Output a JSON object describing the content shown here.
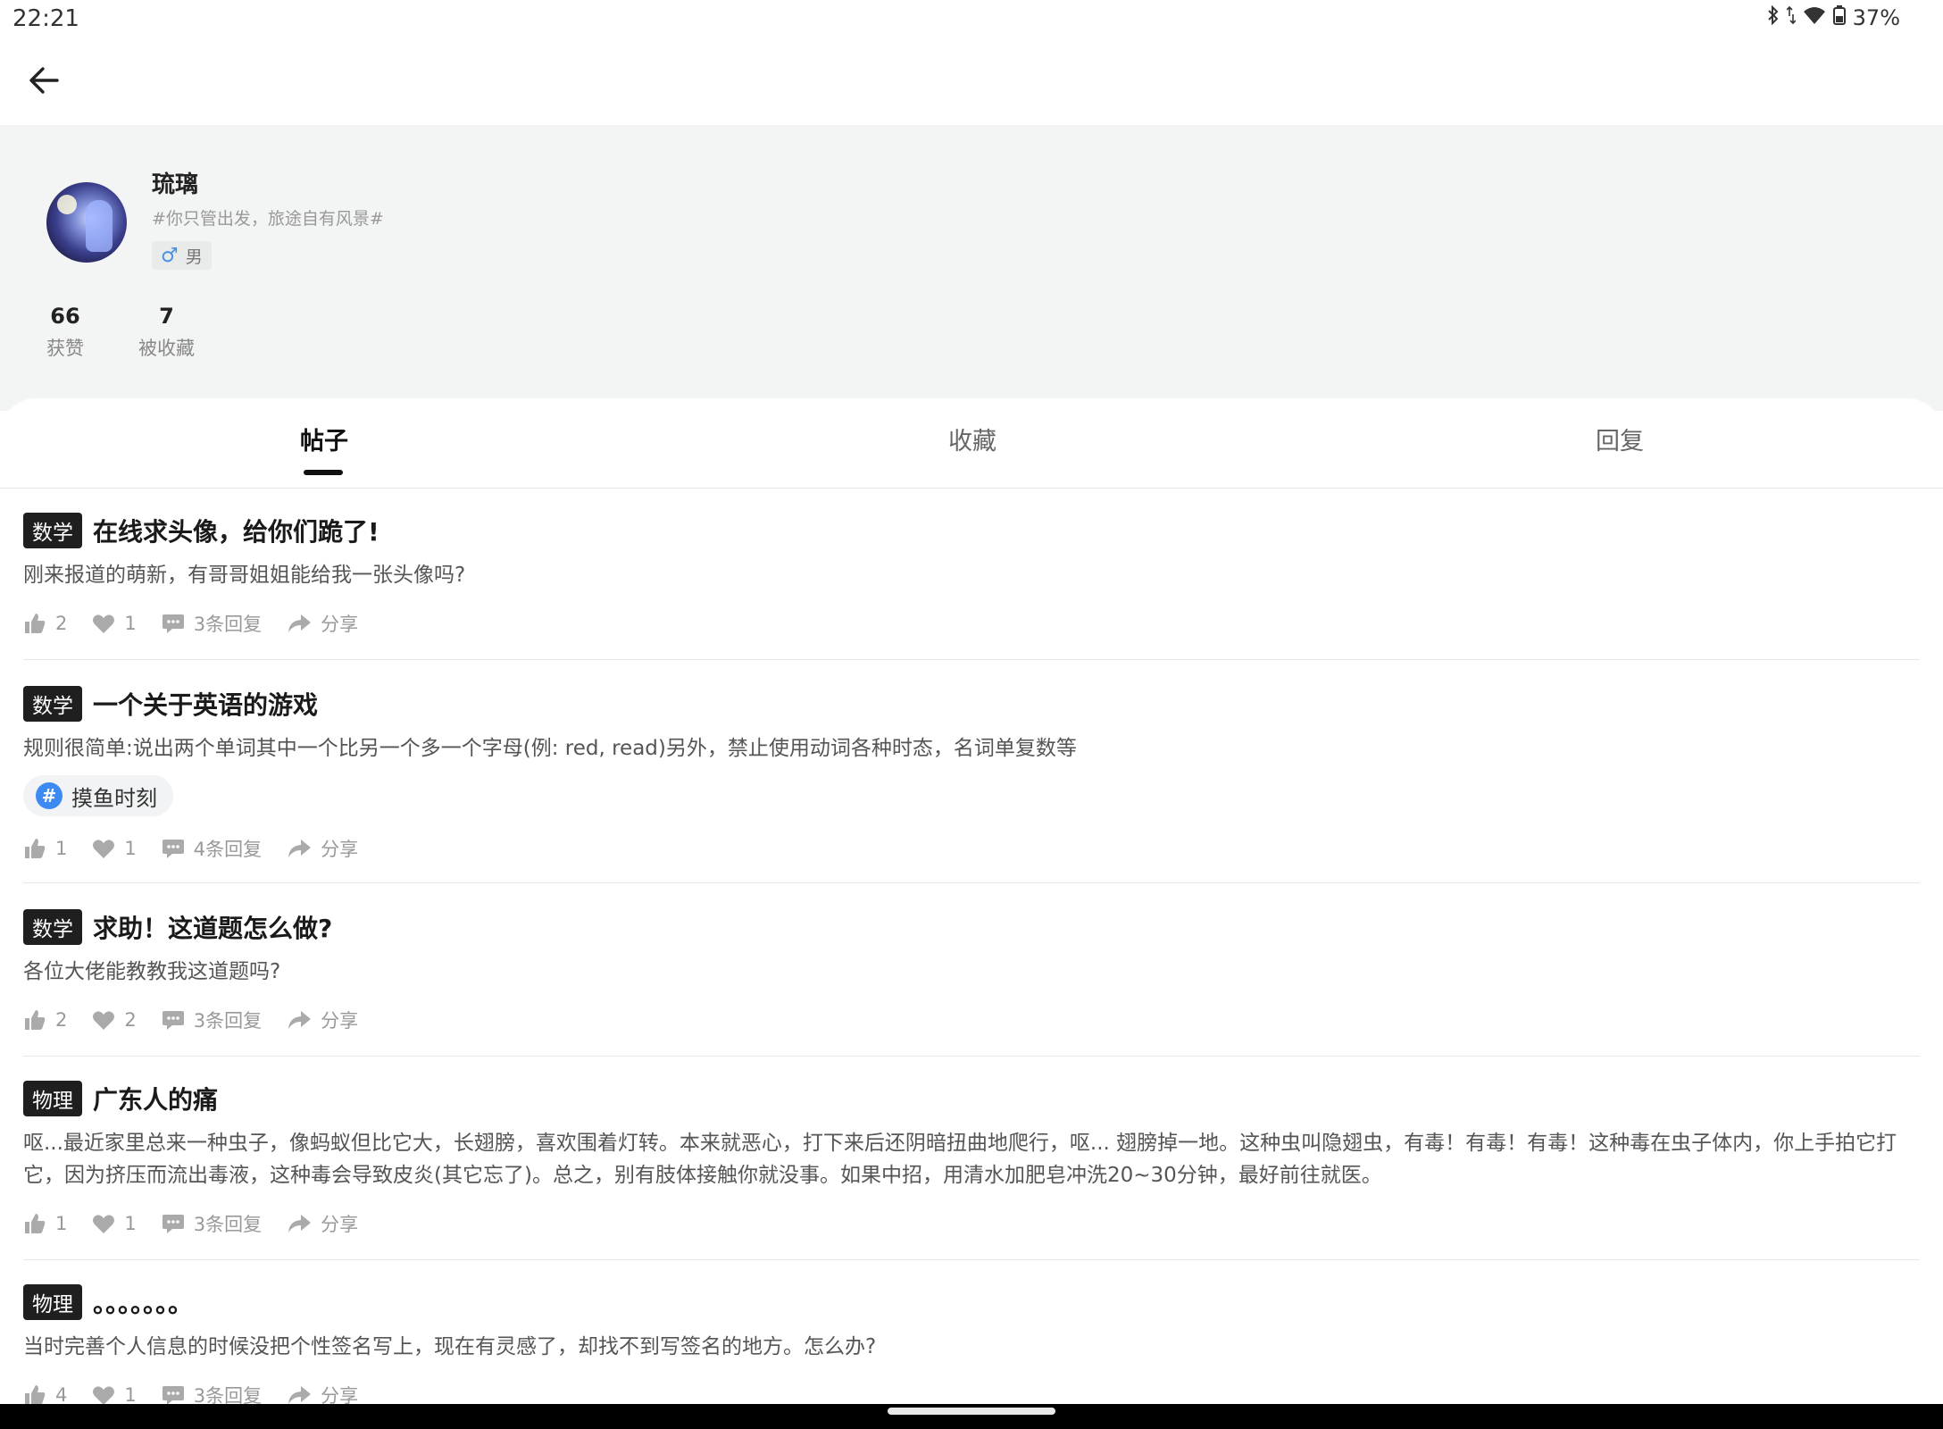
{
  "status": {
    "time": "22:21",
    "battery": "37%"
  },
  "profile": {
    "name": "琉璃",
    "signature": "#你只管出发，旅途自有风景#",
    "gender": "男",
    "stats": [
      {
        "num": "66",
        "label": "获赞"
      },
      {
        "num": "7",
        "label": "被收藏"
      }
    ]
  },
  "tabs": [
    "帖子",
    "收藏",
    "回复"
  ],
  "active_tab": "帖子",
  "posts": [
    {
      "tag": "数学",
      "title": "在线求头像，给你们跪了!",
      "body": "刚来报道的萌新，有哥哥姐姐能给我一张头像吗?",
      "likes": "2",
      "favs": "1",
      "replies": "3条回复",
      "share": "分享"
    },
    {
      "tag": "数学",
      "title": "一个关于英语的游戏",
      "body": "规则很简单:说出两个单词其中一个比另一个多一个字母(例: red, read)另外，禁止使用动词各种时态，名词单复数等",
      "topic": "摸鱼时刻",
      "likes": "1",
      "favs": "1",
      "replies": "4条回复",
      "share": "分享"
    },
    {
      "tag": "数学",
      "title": "求助！这道题怎么做?",
      "body": "各位大佬能教教我这道题吗?",
      "likes": "2",
      "favs": "2",
      "replies": "3条回复",
      "share": "分享"
    },
    {
      "tag": "物理",
      "title": "广东人的痛",
      "body": "呕...最近家里总来一种虫子，像蚂蚁但比它大，长翅膀，喜欢围着灯转。本来就恶心，打下来后还阴暗扭曲地爬行，呕... 翅膀掉一地。这种虫叫隐翅虫，有毒！有毒！有毒！这种毒在虫子体内，你上手拍它打它，因为挤压而流出毒液，这种毒会导致皮炎(其它忘了)。总之，别有肢体接触你就没事。如果中招，用清水加肥皂冲洗20~30分钟，最好前往就医。",
      "likes": "1",
      "favs": "1",
      "replies": "3条回复",
      "share": "分享"
    },
    {
      "tag": "物理",
      "title": "。。。。。。。",
      "body": "当时完善个人信息的时候没把个性签名写上，现在有灵感了，却找不到写签名的地方。怎么办?",
      "likes": "4",
      "favs": "1",
      "replies": "3条回复",
      "share": "分享"
    }
  ],
  "colors": {
    "tag_bg": "#1f1f1f",
    "profile_bg": "#f3f4f4",
    "topic_icon": "#3d8bf2",
    "icon_gray": "#aaaaaa"
  }
}
